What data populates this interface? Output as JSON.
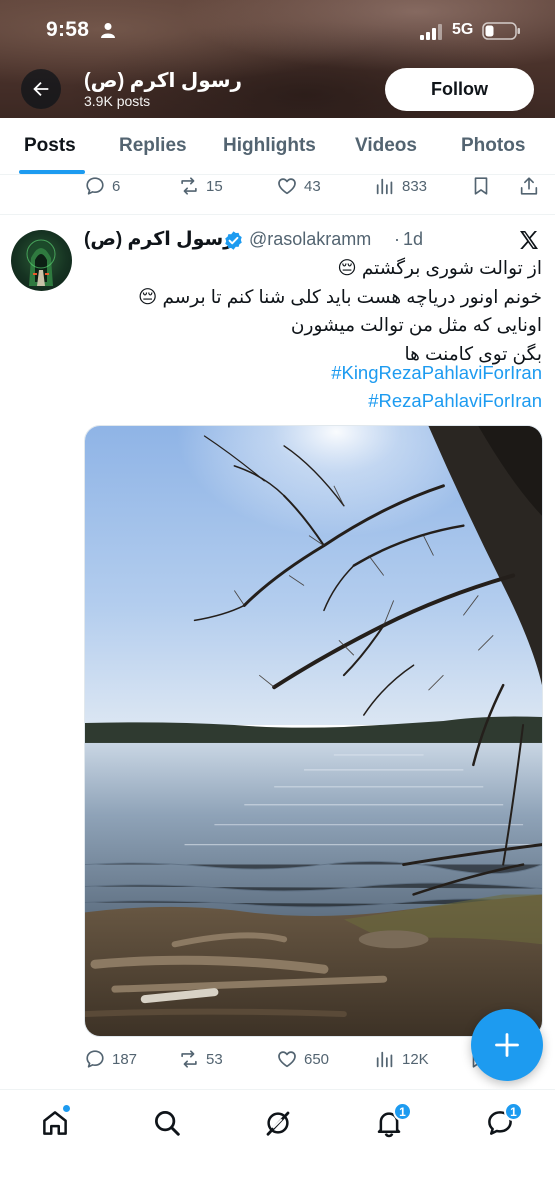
{
  "status_bar": {
    "time": "9:58",
    "network": "5G"
  },
  "header": {
    "profile_name": "رسول اکرم (ص)",
    "post_count": "3.9K posts",
    "follow_label": "Follow",
    "background_color": "#4a322b"
  },
  "tabs": [
    {
      "label": "Posts",
      "active": true
    },
    {
      "label": "Replies",
      "active": false
    },
    {
      "label": "Highlights",
      "active": false
    },
    {
      "label": "Videos",
      "active": false
    },
    {
      "label": "Photos",
      "active": false
    }
  ],
  "previous_post": {
    "replies": "6",
    "reposts": "15",
    "likes": "43",
    "views": "833"
  },
  "post": {
    "author_name": "رسول اکرم (ص)",
    "handle": "@rasolakramm",
    "separator": "·",
    "time": "1d",
    "lines": [
      "از توالت شوری برگشتم 😔",
      "خونم اونور دریاچه هست باید کلی شنا کنم تا برسم 😔",
      "اونایی که مثل من توالت میشورن",
      "بگن توی کامنت ها"
    ],
    "hashtags": [
      "#KingRezaPahlaviForIran",
      "#RezaPahlaviForIran"
    ],
    "image_icon": "lake-photo",
    "replies": "187",
    "reposts": "53",
    "likes": "650",
    "views": "12K"
  },
  "bottom_nav": {
    "notifications_badge": "1",
    "messages_badge": "1"
  },
  "colors": {
    "accent": "#1d9bf0",
    "text": "#0f1419",
    "muted": "#536471"
  }
}
